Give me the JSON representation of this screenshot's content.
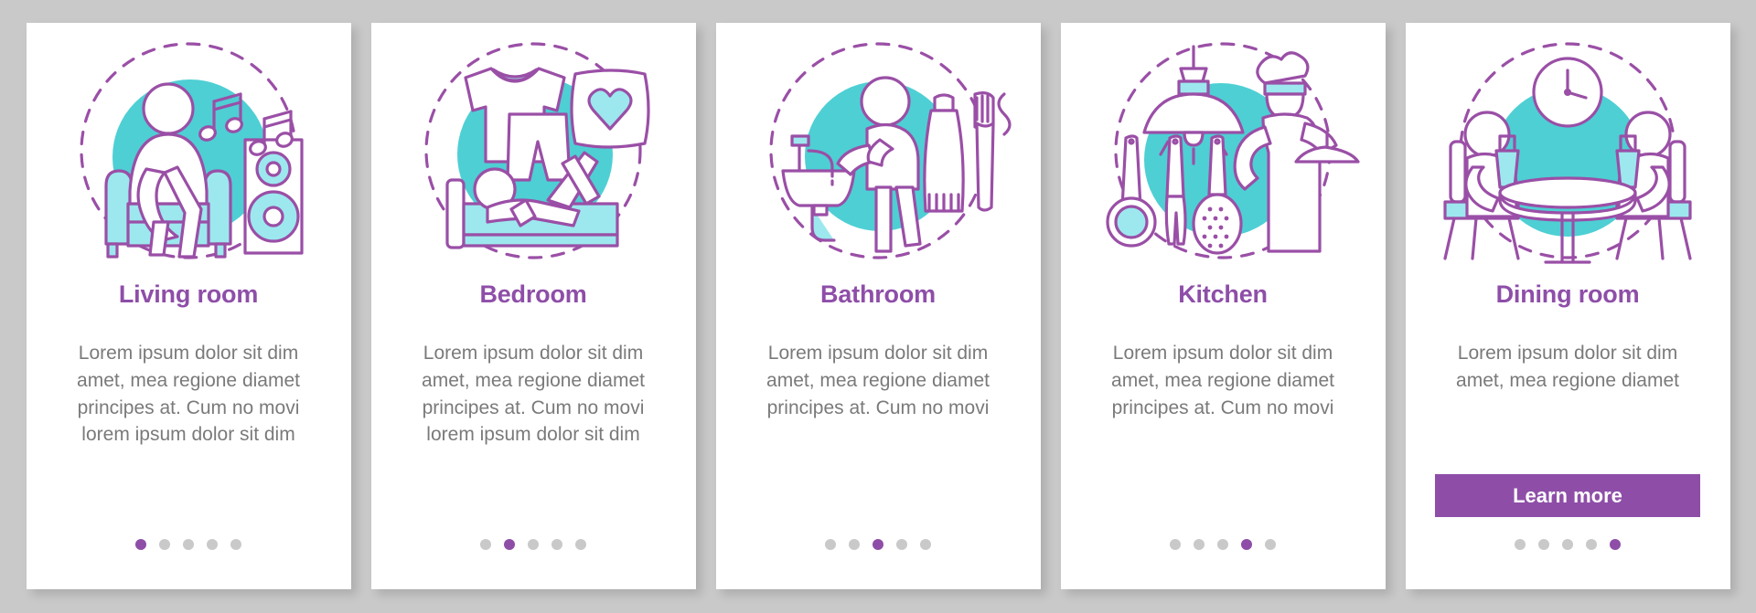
{
  "theme": {
    "background": "#c9c9c9",
    "card_background": "#ffffff",
    "accent_purple": "#8e4ea8",
    "accent_teal": "#4ecfd4",
    "accent_cyan": "#9ce8ee",
    "body_text": "#7a7a7a",
    "dot_inactive": "#c9c9c9"
  },
  "screens": [
    {
      "illustration": "living-room-illustration",
      "title": "Living room",
      "body": "Lorem ipsum dolor sit dim amet, mea regione diamet principes at. Cum no movi lorem ipsum dolor sit dim",
      "button": null,
      "dots": {
        "count": 5,
        "active_index": 0
      }
    },
    {
      "illustration": "bedroom-illustration",
      "title": "Bedroom",
      "body": "Lorem ipsum dolor sit dim amet, mea regione diamet principes at. Cum no movi lorem ipsum dolor sit dim",
      "button": null,
      "dots": {
        "count": 5,
        "active_index": 1
      }
    },
    {
      "illustration": "bathroom-illustration",
      "title": "Bathroom",
      "body": "Lorem ipsum dolor sit dim amet, mea regione diamet principes at. Cum no movi",
      "button": null,
      "dots": {
        "count": 5,
        "active_index": 2
      }
    },
    {
      "illustration": "kitchen-illustration",
      "title": "Kitchen",
      "body": "Lorem ipsum dolor sit dim amet, mea regione diamet principes at. Cum no movi",
      "button": null,
      "dots": {
        "count": 5,
        "active_index": 3
      }
    },
    {
      "illustration": "dining-room-illustration",
      "title": "Dining room",
      "body": "Lorem ipsum dolor sit dim amet, mea regione diamet",
      "button": "Learn more",
      "dots": {
        "count": 5,
        "active_index": 4
      }
    }
  ]
}
